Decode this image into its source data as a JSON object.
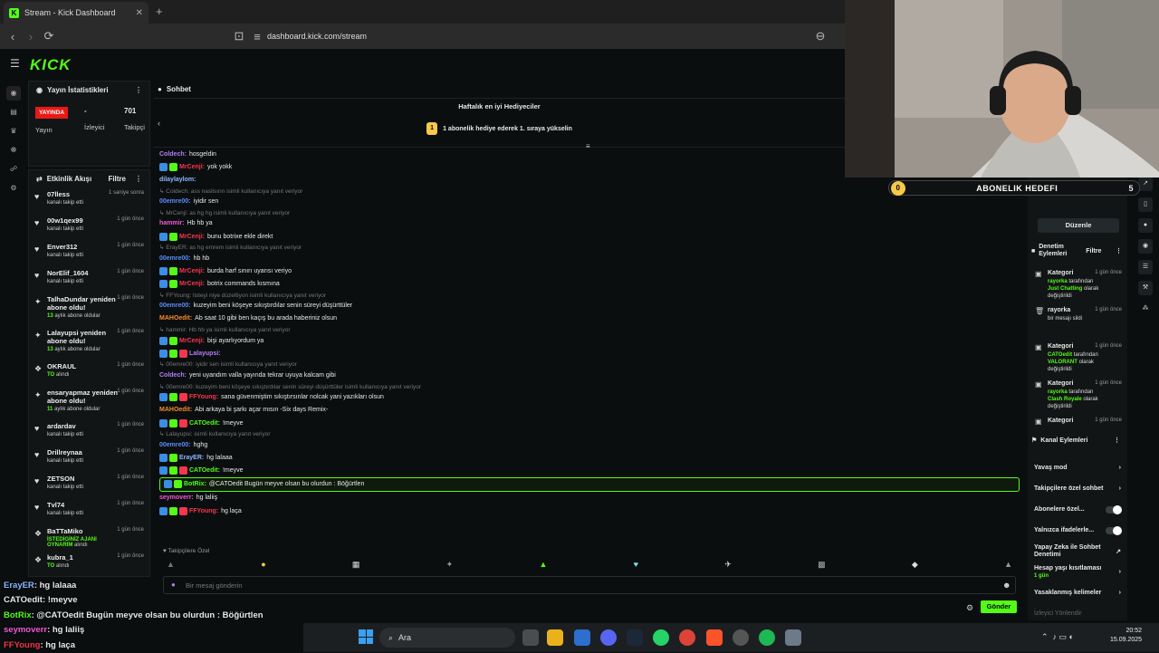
{
  "browser": {
    "tab_title": "Stream - Kick Dashboard",
    "url": "dashboard.kick.com/stream"
  },
  "brand": {
    "logo": "KICK",
    "accent": "#53fc18"
  },
  "stats": {
    "title": "Yayın İstatistikleri",
    "live_badge": "YAYINDA",
    "live_label": "Yayın",
    "viewers_value": "-",
    "viewers_label": "İzleyici",
    "followers_value": "701",
    "followers_label": "Takipçi"
  },
  "activity": {
    "title": "Etkinlik Akışı",
    "filter": "Filtre",
    "items": [
      {
        "icon": "heart-icon",
        "name": "07lless",
        "sub": "kanalı takip etti",
        "time": "1 saniye sonra"
      },
      {
        "icon": "heart-icon",
        "name": "00w1qex99",
        "sub": "kanalı takip etti",
        "time": "1 gün önce"
      },
      {
        "icon": "heart-icon",
        "name": "Enver312",
        "sub": "kanalı takip etti",
        "time": "1 gün önce"
      },
      {
        "icon": "heart-icon",
        "name": "NorElif_1604",
        "sub": "kanalı takip etti",
        "time": "1 gün önce"
      },
      {
        "icon": "star-icon",
        "name": "TalhaDundar yeniden abone oldu!",
        "hl": "13",
        "sub": "aylık abone oldular",
        "time": "1 gün önce"
      },
      {
        "icon": "star-icon",
        "name": "Lalayupsi yeniden abone oldu!",
        "hl": "13",
        "sub": "aylık abone oldular",
        "time": "1 gün önce"
      },
      {
        "icon": "gift-icon",
        "name": "OKRAUL",
        "hl": "TO",
        "sub": "alındı",
        "time": "1 gün önce"
      },
      {
        "icon": "star-icon",
        "name": "ensaryapmaz yeniden abone oldu!",
        "hl": "11",
        "sub": "aylık abone oldular",
        "time": "1 gün önce"
      },
      {
        "icon": "heart-icon",
        "name": "ardardav",
        "sub": "kanalı takip etti",
        "time": "1 gün önce"
      },
      {
        "icon": "heart-icon",
        "name": "Drillreynaa",
        "sub": "kanalı takip etti",
        "time": "1 gün önce"
      },
      {
        "icon": "heart-icon",
        "name": "ZETSON",
        "sub": "kanalı takip etti",
        "time": "1 gün önce"
      },
      {
        "icon": "heart-icon",
        "name": "Tvl74",
        "sub": "kanalı takip etti",
        "time": "1 gün önce"
      },
      {
        "icon": "gift-icon",
        "name": "BaTTaMiko",
        "hl": "İSTEDİGİNİZ AJANI OYNARIM",
        "sub": "alındı",
        "time": "1 gün önce"
      },
      {
        "icon": "gift-icon",
        "name": "kubra_1",
        "hl": "TO",
        "sub": "alındı",
        "time": "1 gün önce"
      }
    ]
  },
  "chat": {
    "title": "Sohbet",
    "gifters_title": "Haftalık en iyi Hediyeciler",
    "gifters_text": "1 abonelik hediye ederek 1. sıraya yükselin",
    "messages": [
      {
        "user": "Coldech",
        "color": "#b57cf5",
        "text": "hosgeldin"
      },
      {
        "user": "MrCenji",
        "color": "#f5364d",
        "text": "yok yokk",
        "badges": 2
      },
      {
        "user": "dilaylaylom",
        "color": "#8bb8ff",
        "text": ""
      },
      {
        "reply": "Coldech: ass naslisınn isimli kullanıcıya yanıt veriyor"
      },
      {
        "user": "00emre00",
        "color": "#5b8cff",
        "text": "iyidir sen"
      },
      {
        "reply": "MrCenji: as hg hg isimli kullanıcıya yanıt veriyor"
      },
      {
        "user": "hammir",
        "color": "#f05ad6",
        "text": "Hb hb ya"
      },
      {
        "user": "MrCenji",
        "color": "#f5364d",
        "text": "bunu botrixe ekle direkt",
        "badges": 2
      },
      {
        "reply": "ErayER: as hg emrem isimli kullanıcıya yanıt veriyor"
      },
      {
        "user": "00emre00",
        "color": "#5b8cff",
        "text": "hb hb"
      },
      {
        "user": "MrCenji",
        "color": "#f5364d",
        "text": "burda harf sınırı uyarısı veriyo",
        "badges": 2
      },
      {
        "user": "MrCenji",
        "color": "#f5364d",
        "text": "botrix commands kısmına",
        "badges": 2
      },
      {
        "reply": "FFYoung: listeyi niye düzeltiyon isimli kullanıcıya yanıt veriyor"
      },
      {
        "user": "00emre00",
        "color": "#5b8cff",
        "text": "kuzeyim beni köşeye sıkıştırdılar senin süreyi düşürttüler"
      },
      {
        "user": "MAHOedit",
        "color": "#f58a2c",
        "text": "Ab saat 10 gibi ben kaçış bu arada haberiniz olsun"
      },
      {
        "reply": "hammir: Hb hb ya isimli kullanıcıya yanıt veriyor"
      },
      {
        "user": "MrCenji",
        "color": "#f5364d",
        "text": "bişi ayarlıyordum ya",
        "badges": 2
      },
      {
        "user": "Lalayupsi",
        "color": "#b57cf5",
        "text": "",
        "badges": 3
      },
      {
        "reply": "00emre00: iyidir sen isimli kullanıcıya yanıt veriyor"
      },
      {
        "user": "Coldech",
        "color": "#b57cf5",
        "text": "yeni uyandım valla yayında tekrar uyuya kalcam gibi"
      },
      {
        "reply": "00emre00: kuzeyim beni köşeye sıkıştırdılar senin süreyi düşürttüler isimli kullanıcıya yanıt veriyor"
      },
      {
        "user": "FFYoung",
        "color": "#f5364d",
        "text": "sana güvenmiştim sıkıştırsınlar nolcak yani yazıkları olsun",
        "badges": 3
      },
      {
        "user": "MAHOedit",
        "color": "#f58a2c",
        "text": "Abi arkaya bi şarkı açar mısın -Six days Remix-"
      },
      {
        "user": "CATOedit",
        "color": "#53fc18",
        "text": "!meyve",
        "badges": 3
      },
      {
        "reply": "Lalayupsi: isimli kullanıcıya yanıt veriyor"
      },
      {
        "user": "00emre00",
        "color": "#5b8cff",
        "text": "hghg"
      },
      {
        "user": "ErayER",
        "color": "#8bb8ff",
        "text": "hg lalaaa",
        "badges": 2
      },
      {
        "user": "CATOedit",
        "color": "#53fc18",
        "text": "!meyve",
        "badges": 3
      },
      {
        "user": "BotRix",
        "color": "#53fc18",
        "text": "@CATOedit Bugün meyve olsan bu olurdun : Böğürtlen",
        "badges": 2,
        "highlight": true
      },
      {
        "user": "seymoverr",
        "color": "#f05ad6",
        "text": "hg laliiş"
      },
      {
        "user": "FFYoung",
        "color": "#f5364d",
        "text": "hg laça",
        "badges": 3
      }
    ],
    "followers_only": "Takipçilere Özel",
    "input_placeholder": "Bir mesaj gönderin",
    "send": "Gönder"
  },
  "goal": {
    "label": "ABONELIK HEDEFI",
    "current": "0",
    "target": "5"
  },
  "right": {
    "edit": "Düzenle",
    "mod_title": "Denetim Eylemleri",
    "filter": "Filtre",
    "mod_items": [
      {
        "icon": "category-icon",
        "name": "Kategori",
        "time": "1 gün önce",
        "user": "rayorka",
        "mid": "tarafından",
        "hl": "Just Chatting",
        "end": "olarak değiştirildi"
      },
      {
        "icon": "trash-icon",
        "name": "rayorka",
        "time": "1 gün önce",
        "user": "",
        "mid": "bir mesajı sildi",
        "hl": "",
        "end": ""
      },
      {
        "icon": "category-icon",
        "name": "Kategori",
        "time": "1 gün önce",
        "user": "CATOedit",
        "mid": "tarafından",
        "hl": "VALORANT",
        "end": "olarak değiştirildi"
      },
      {
        "icon": "category-icon",
        "name": "Kategori",
        "time": "1 gün önce",
        "user": "rayorka",
        "mid": "tarafından",
        "hl": "Clash Royale",
        "end": "olarak değiştirildi"
      },
      {
        "icon": "category-icon",
        "name": "Kategori",
        "time": "1 gün önce",
        "user": "",
        "mid": "",
        "hl": "",
        "end": ""
      }
    ],
    "channel_title": "Kanal Eylemleri",
    "channel_items": [
      {
        "label": "Yavaş mod",
        "ctl": "arrow"
      },
      {
        "label": "Takipçilere özel sohbet",
        "ctl": "arrow"
      },
      {
        "label": "Abonelere özel...",
        "ctl": "toggle"
      },
      {
        "label": "Yalnızca ifadelerle...",
        "ctl": "toggle"
      },
      {
        "label": "Yapay Zeka ile Sohbet Denetimi",
        "ctl": "ext"
      },
      {
        "label": "Hesap yaşı kısıtlaması",
        "sub": "1 gün",
        "ctl": "arrow"
      },
      {
        "label": "Yasaklanmış kelimeler",
        "ctl": "arrow"
      },
      {
        "label": "İzleyici Yönlendir",
        "ctl": "none"
      }
    ]
  },
  "overlay": [
    {
      "user": "ErayER",
      "color": "#8bb8ff",
      "text": ": hg lalaaa"
    },
    {
      "user": "CATOedit",
      "color": "#e8e8e8",
      "text": ": !meyve"
    },
    {
      "user": "BotRix",
      "color": "#53fc18",
      "text": ": @CATOedit Bugün meyve olsan bu olurdun : Böğürtlen"
    },
    {
      "user": "seymoverr",
      "color": "#f05ad6",
      "text": ": hg laliiş"
    },
    {
      "user": "FFYoung",
      "color": "#f5364d",
      "text": ": hg laça"
    }
  ],
  "taskbar": {
    "search": "Ara",
    "time": "20:52",
    "date": "15.09.2025"
  }
}
